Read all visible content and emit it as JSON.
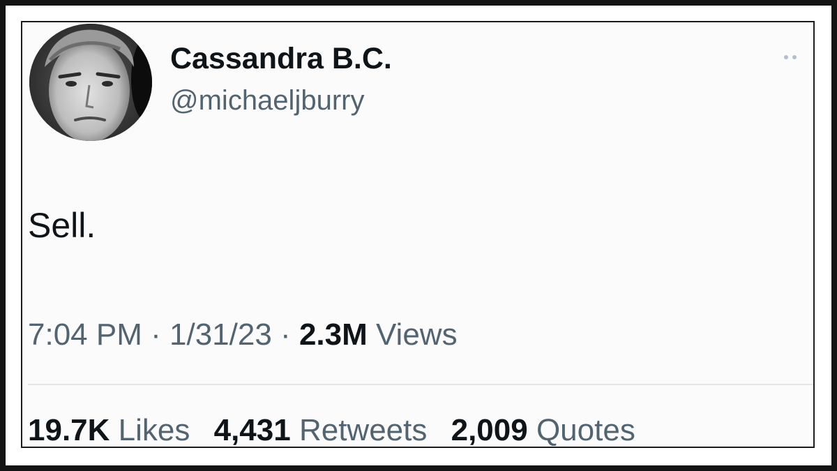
{
  "tweet": {
    "author": {
      "display_name": "Cassandra B.C.",
      "handle": "@michaeljburry"
    },
    "more_icon": "more-dots-icon",
    "text": "Sell.",
    "meta": {
      "time": "7:04 PM",
      "separator": "·",
      "date": "1/31/23",
      "views_count": "2.3M",
      "views_label": "Views"
    },
    "stats": {
      "likes_count": "19.7K",
      "likes_label": "Likes",
      "retweets_count": "4,431",
      "retweets_label": "Retweets",
      "quotes_count": "2,009",
      "quotes_label": "Quotes"
    }
  },
  "colors": {
    "frame": "#141414",
    "text_primary": "#0f1419",
    "text_secondary": "#536471",
    "divider": "#e3e6e9"
  }
}
